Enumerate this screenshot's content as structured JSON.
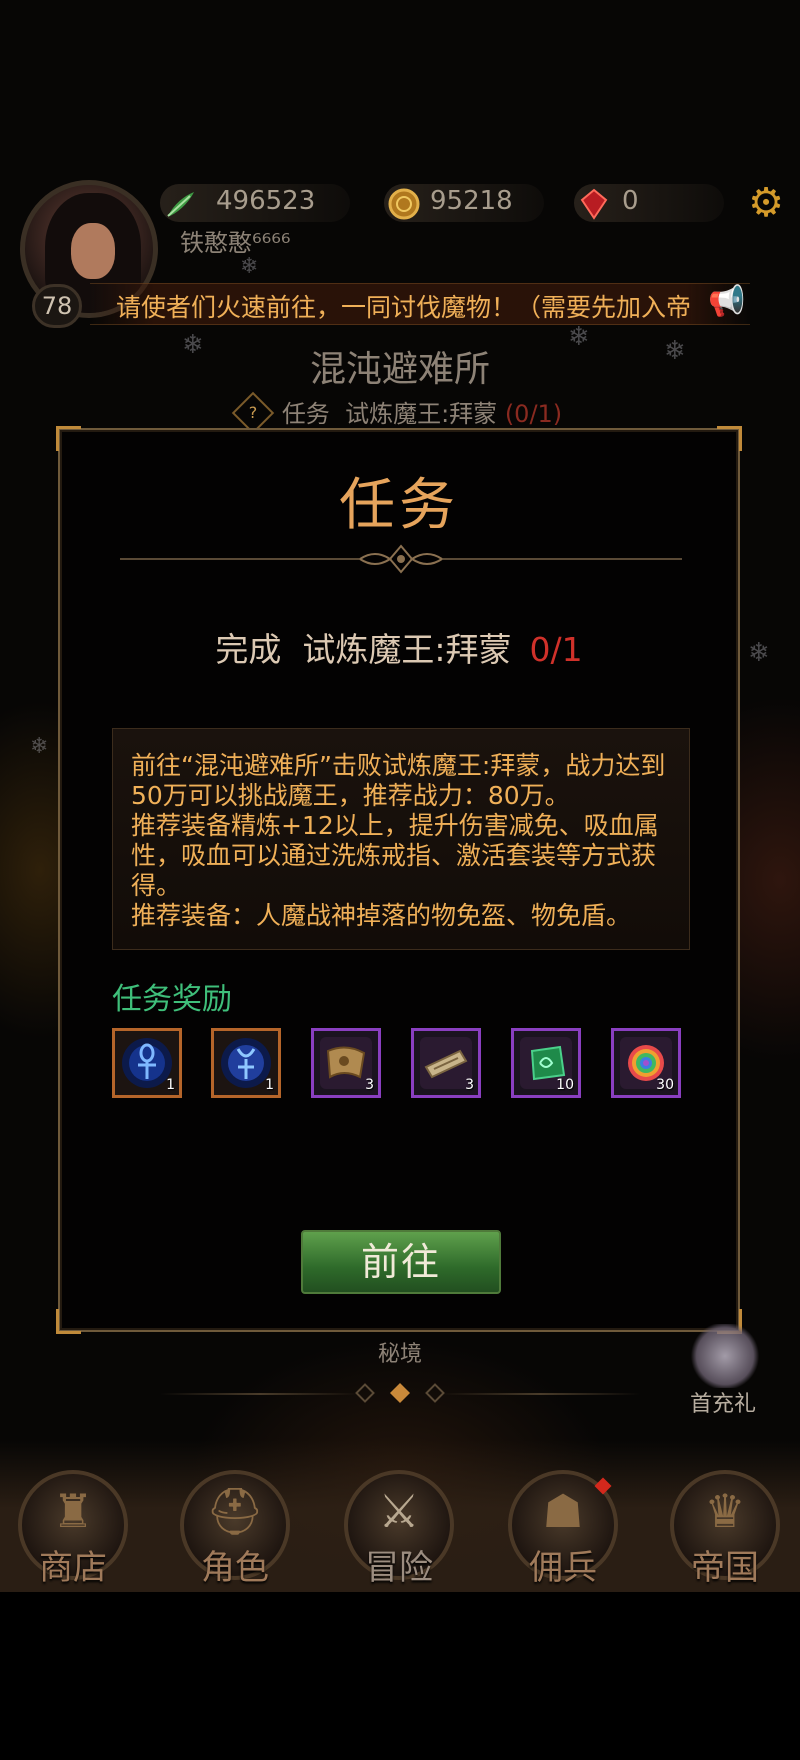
{
  "player": {
    "level": "78",
    "name": "铁憨憨⁶⁶⁶⁶"
  },
  "resources": [
    {
      "icon": "green-feather-icon",
      "value": "496523"
    },
    {
      "icon": "gold-coin-icon",
      "value": "95218"
    },
    {
      "icon": "red-gem-icon",
      "value": "0"
    }
  ],
  "marquee": {
    "text": "请使者们火速前往，一同讨伐魔物！（需要先加入帝"
  },
  "location": {
    "title": "混沌避难所",
    "task_prefix": "任务",
    "task_name": "试炼魔王:拜蒙",
    "task_progress": "(0/1)"
  },
  "modal": {
    "title": "任务",
    "objective_prefix": "完成",
    "objective_name": "试炼魔王:拜蒙",
    "objective_progress": "0/1",
    "description": "前往“混沌避难所”击败试炼魔王:拜蒙，战力达到50万可以挑战魔王，推荐战力：80万。\n推荐装备精炼+12以上，提升伤害减免、吸血属性，吸血可以通过洗炼戒指、激活套装等方式获得。\n推荐装备：人魔战神掉落的物免盔、物免盾。",
    "reward_title": "任务奖励",
    "rewards": [
      {
        "icon": "blue-ankh-rune-14-icon",
        "qty": "1",
        "rarity": "orange"
      },
      {
        "icon": "blue-ankh-rune-15-icon",
        "qty": "1",
        "rarity": "orange"
      },
      {
        "icon": "treasure-map-scroll-icon",
        "qty": "3",
        "rarity": "purple"
      },
      {
        "icon": "parchment-ticket-icon",
        "qty": "3",
        "rarity": "purple"
      },
      {
        "icon": "green-emerald-icon",
        "qty": "10",
        "rarity": "purple"
      },
      {
        "icon": "rainbow-orb-icon",
        "qty": "30",
        "rarity": "purple"
      }
    ],
    "go_button": "前往"
  },
  "secret_realm": "秘境",
  "first_charge": "首充礼",
  "nav": [
    {
      "label": "商店",
      "icon": "shop-castle-icon"
    },
    {
      "label": "角色",
      "icon": "character-helmet-icon"
    },
    {
      "label": "冒险",
      "icon": "adventure-swords-icon"
    },
    {
      "label": "佣兵",
      "icon": "mercenary-hood-icon"
    },
    {
      "label": "帝国",
      "icon": "empire-crown-icon"
    }
  ],
  "colors": {
    "accent_orange": "#e6a45c",
    "progress_red": "#d0312a",
    "reward_green": "#3fbf7a",
    "button_green": "#3f8a36"
  }
}
